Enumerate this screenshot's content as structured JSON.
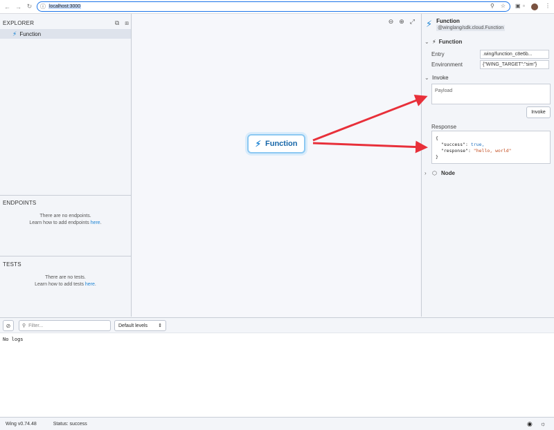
{
  "browser": {
    "url": "localhost:3000",
    "icons": [
      "back-icon",
      "forward-icon",
      "reload-icon",
      "info-icon",
      "zoom-icon",
      "bookmark-star-icon",
      "extensions-icon",
      "split-view-icon",
      "profile-avatar",
      "menu-icon"
    ]
  },
  "explorer": {
    "title": "EXPLORER",
    "items": [
      {
        "label": "Function",
        "icon": "bolt-icon"
      }
    ]
  },
  "endpoints": {
    "title": "ENDPOINTS",
    "empty_line1": "There are no endpoints.",
    "empty_pre": "Learn how to add endpoints ",
    "empty_link": "here",
    "empty_post": "."
  },
  "tests": {
    "title": "TESTS",
    "empty_line1": "There are no tests.",
    "empty_pre": "Learn how to add tests ",
    "empty_link": "here",
    "empty_post": "."
  },
  "canvas": {
    "node_label": "Function"
  },
  "inspector": {
    "title": "Function",
    "subtitle": "@winglang/sdk.cloud.Function",
    "function_section": "Function",
    "entry_label": "Entry",
    "entry_value": ".wing/function_c8e6b...",
    "env_label": "Environment",
    "env_value": "{\"WING_TARGET\":\"sim\"}",
    "invoke_section": "Invoke",
    "payload_placeholder": "Payload",
    "invoke_button": "Invoke",
    "response_label": "Response",
    "response": {
      "open": "{",
      "success_key": "\"success\": ",
      "success_val": "true,",
      "response_key": "\"response\": ",
      "response_val": "\"hello, world\"",
      "close": "}"
    },
    "node_section": "Node"
  },
  "logs": {
    "filter_placeholder": "Filter...",
    "level_select": "Default levels",
    "empty": "No logs"
  },
  "statusbar": {
    "version": "Wing v0.74.48",
    "status": "Status: success"
  },
  "colors": {
    "accent": "#1d84d4",
    "annotation_arrow": "#e8303a",
    "url_outline": "#1a73e8"
  }
}
